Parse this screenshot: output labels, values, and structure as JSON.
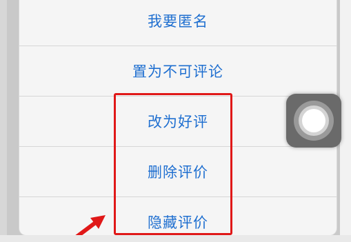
{
  "action_sheet": {
    "items": [
      {
        "label": "我要匿名"
      },
      {
        "label": "置为不可评论"
      },
      {
        "label": "改为好评"
      },
      {
        "label": "删除评价"
      },
      {
        "label": "隐藏评价"
      }
    ]
  },
  "colors": {
    "item_text": "#1f6fd0",
    "highlight": "#e01818",
    "arrow": "#e01818"
  },
  "icons": {
    "assistive_touch": "assistive-touch-icon",
    "annotation_arrow": "arrow-icon"
  }
}
